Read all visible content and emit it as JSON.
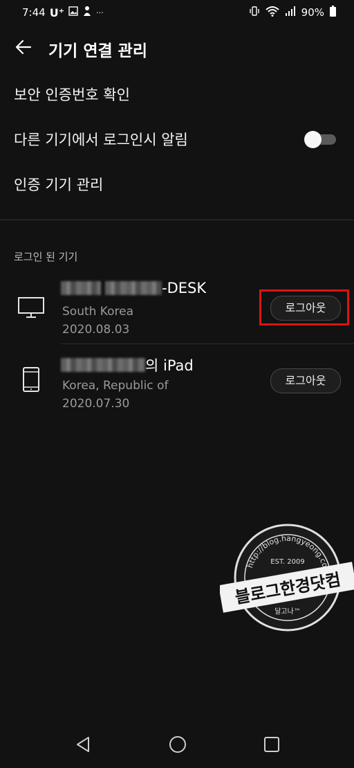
{
  "status_bar": {
    "time": "7:44",
    "carrier": "U⁺",
    "more": "···",
    "battery": "90%"
  },
  "header": {
    "title": "기기 연결 관리"
  },
  "menu": {
    "security_code": "보안 인증번호 확인",
    "login_alert": "다른 기기에서 로그인시 알림",
    "login_alert_enabled": false,
    "auth_devices": "인증 기기 관리"
  },
  "logged_in": {
    "section_label": "로그인 된 기기",
    "devices": [
      {
        "name_suffix": "-DESK",
        "country": "South Korea",
        "date": "2020.08.03",
        "logout_label": "로그아웃",
        "icon": "monitor-icon"
      },
      {
        "name_suffix": "의 iPad",
        "country": "Korea, Republic of",
        "date": "2020.07.30",
        "logout_label": "로그아웃",
        "icon": "tablet-icon"
      }
    ]
  },
  "watermark": {
    "url": "http://blog.hangyeong.com",
    "est": "EST. 2009",
    "name": "블로그한경닷컴",
    "sub": "달고나™"
  },
  "colors": {
    "background": "#121212",
    "highlight": "#d81616"
  }
}
